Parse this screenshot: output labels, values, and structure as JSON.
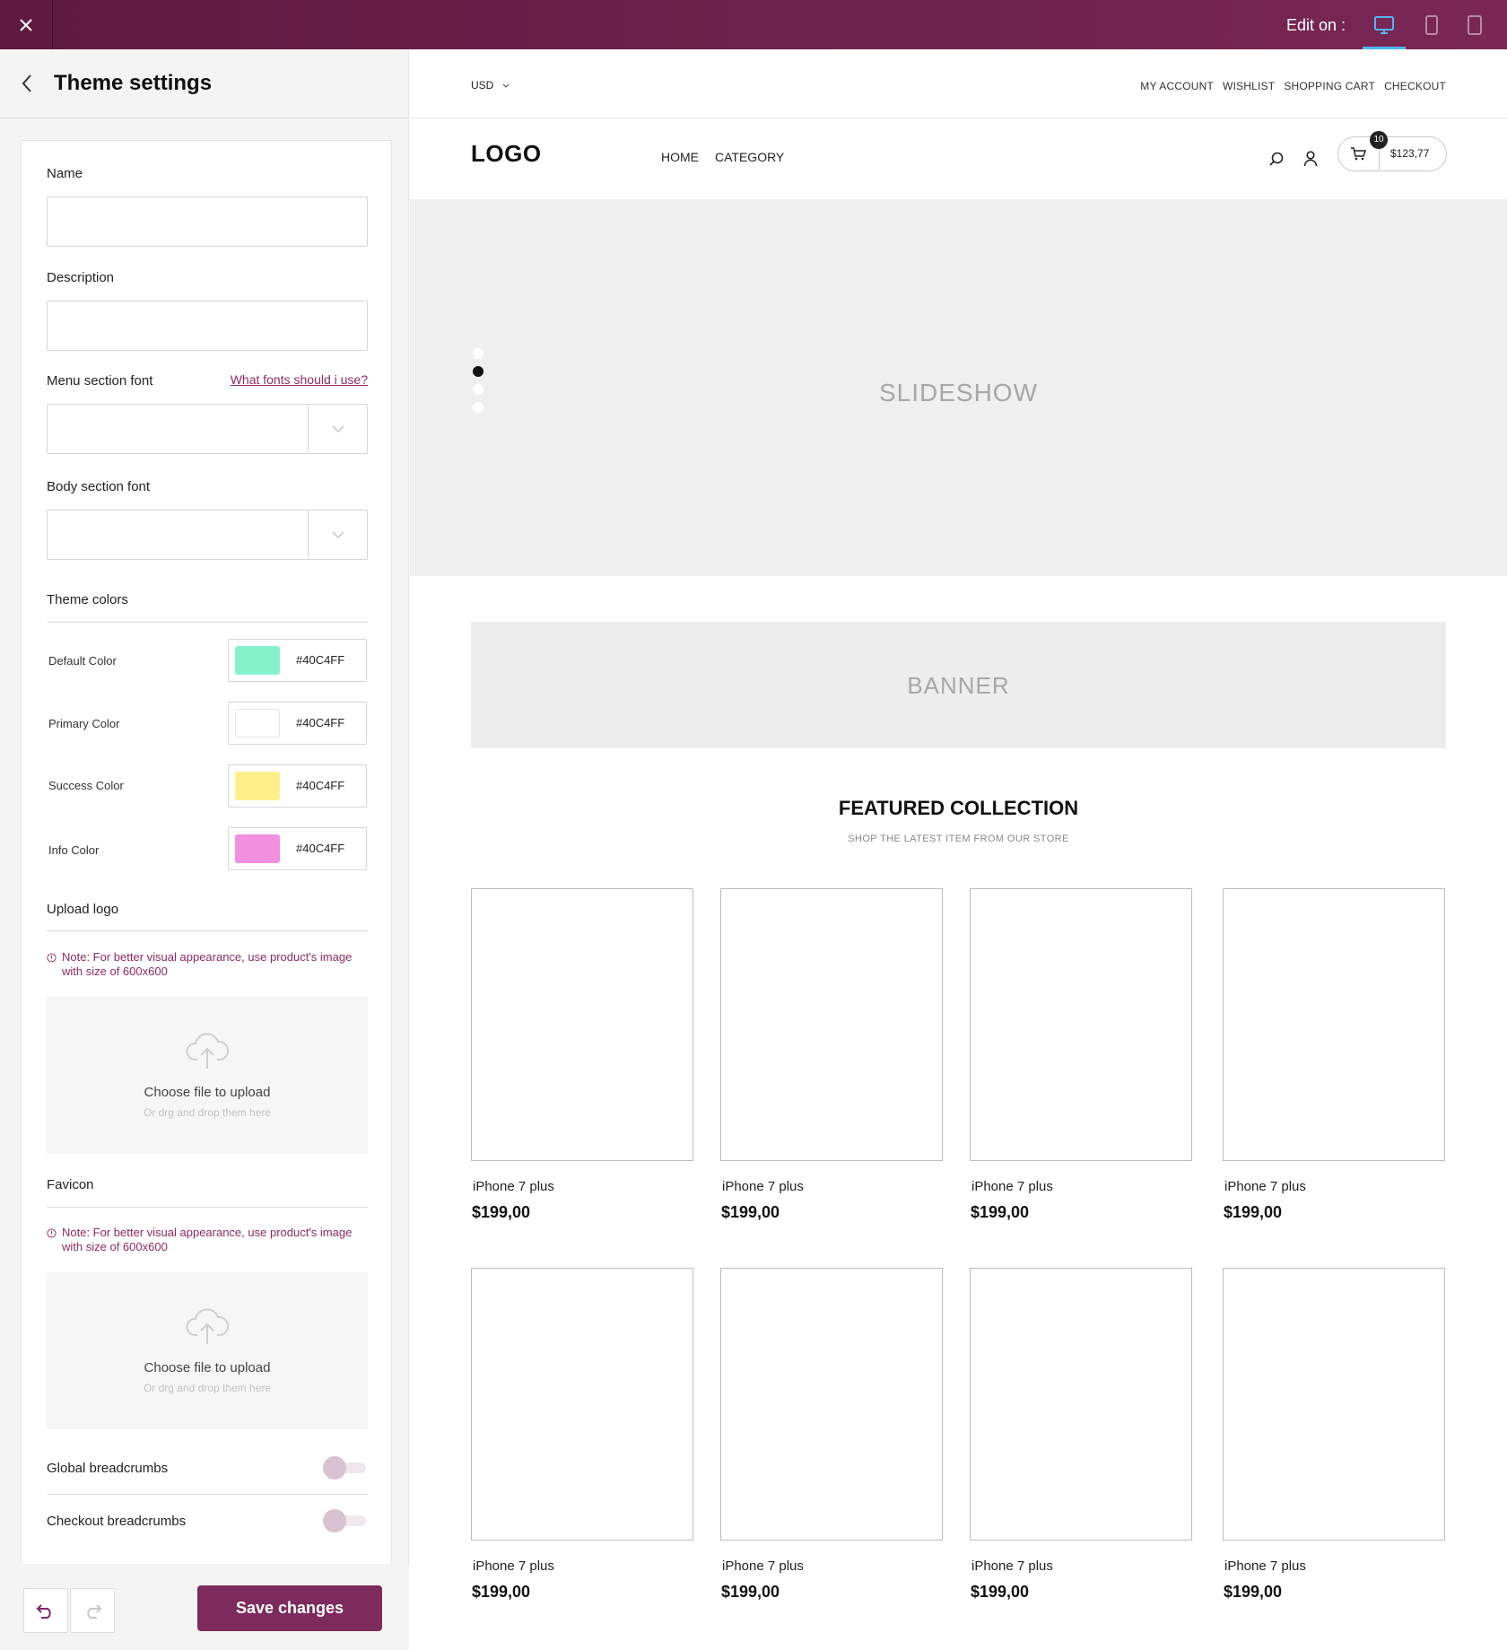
{
  "topbar": {
    "edit_label": "Edit on :",
    "devices": [
      "desktop-icon",
      "tablet-icon",
      "mobile-icon"
    ],
    "active_color": "#4fb8ef",
    "bg": "#6b1f4a"
  },
  "panel": {
    "title": "Theme settings",
    "fields": {
      "name_label": "Name",
      "name_value": "",
      "description_label": "Description",
      "description_value": "",
      "menu_font_label": "Menu section font",
      "fonts_link": "What fonts should i use?",
      "menu_font_value": "",
      "body_font_label": "Body section font",
      "body_font_value": ""
    },
    "theme_colors": {
      "heading": "Theme colors",
      "items": [
        {
          "label": "Default Color",
          "hex": "#40C4FF",
          "swatch": "#86f2cb"
        },
        {
          "label": "Primary Color",
          "hex": "#40C4FF",
          "swatch": "#ffffff"
        },
        {
          "label": "Success Color",
          "hex": "#40C4FF",
          "swatch": "#fff08c"
        },
        {
          "label": "Info Color",
          "hex": "#40C4FF",
          "swatch": "#f28fdf"
        }
      ]
    },
    "upload_logo": {
      "heading": "Upload logo",
      "note": "Note: For better visual appearance, use product's image with size of 600x600",
      "choose": "Choose file to upload",
      "drop": "Or drg and drop them here"
    },
    "favicon": {
      "heading": "Favicon",
      "note": "Note: For better visual appearance, use product's image with size of 600x600",
      "choose": "Choose file to upload",
      "drop": "Or drg and drop them here"
    },
    "toggles": {
      "global_breadcrumbs": "Global breadcrumbs",
      "checkout_breadcrumbs": "Checkout breadcrumbs",
      "global_on": false,
      "checkout_on": false
    },
    "save_label": "Save changes",
    "accent": "#7d2b5c"
  },
  "preview": {
    "currency": "USD",
    "top_links": [
      "MY ACCOUNT",
      "WISHLIST",
      "SHOPPING CART",
      "CHECKOUT"
    ],
    "logo": "LOGO",
    "menu": [
      "HOME",
      "CATEGORY"
    ],
    "cart_count": "10",
    "cart_total": "$123,77",
    "slideshow_label": "SLIDESHOW",
    "banner_label": "BANNER",
    "featured_title": "FEATURED COLLECTION",
    "featured_subtitle": "SHOP THE LATEST ITEM FROM OUR STORE",
    "products": [
      {
        "name": "iPhone 7 plus",
        "price": "$199,00"
      },
      {
        "name": "iPhone 7 plus",
        "price": "$199,00"
      },
      {
        "name": "iPhone 7 plus",
        "price": "$199,00"
      },
      {
        "name": "iPhone 7 plus",
        "price": "$199,00"
      },
      {
        "name": "iPhone 7 plus",
        "price": "$199,00"
      },
      {
        "name": "iPhone 7 plus",
        "price": "$199,00"
      },
      {
        "name": "iPhone 7 plus",
        "price": "$199,00"
      },
      {
        "name": "iPhone 7 plus",
        "price": "$199,00"
      }
    ]
  }
}
